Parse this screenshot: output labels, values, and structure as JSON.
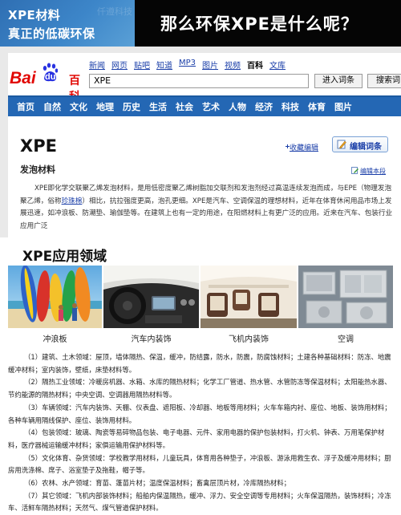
{
  "banner": {
    "line1": "XPE材料",
    "line2": "真正的低碳环保",
    "watermark": "仟遵科技",
    "question": "那么环保XPE是什么呢？"
  },
  "logo": {
    "bai": "Bai",
    "du": "du",
    "baike": "百科"
  },
  "top_nav": {
    "items": [
      "新闻",
      "网页",
      "贴吧",
      "知道",
      "MP3",
      "图片",
      "视频",
      "百科",
      "文库"
    ],
    "current": "百科"
  },
  "search": {
    "value": "XPE",
    "enter_label": "进入词条",
    "search_label": "搜索词"
  },
  "categories": [
    "首页",
    "自然",
    "文化",
    "地理",
    "历史",
    "生活",
    "社会",
    "艺术",
    "人物",
    "经济",
    "科技",
    "体育",
    "图片"
  ],
  "entry": {
    "title": "XPE",
    "favorite_label": "收藏编辑",
    "edit_label": "编辑词条",
    "subtitle": "发泡材料",
    "edit_section_label": "编辑本段",
    "paragraph_a": "XPE即化学交联聚乙烯发泡材料，是用低密度聚乙烯树脂加交联剂和发泡剂经过高温连续发泡而成，与EPE（物理发泡聚乙烯，俗称",
    "paragraph_link": "珍珠棉",
    "paragraph_b": "）相比，抗拉强度更高，泡孔更细。XPE是汽车、空调保温的理想材料，近年在体育休闲用品市场上发展迅速，如冲浪板、防潮垫、瑜伽垫等。在建筑上也有一定的用途，在阳燃材料上有更广泛的应用。近来在汽车、包装行业应用广泛"
  },
  "applications": {
    "title": "XPE应用领域",
    "photos": [
      {
        "caption": "冲浪板"
      },
      {
        "caption": "汽车内装饰"
      },
      {
        "caption": "飞机内装饰"
      },
      {
        "caption": "空调"
      }
    ],
    "items": [
      "（1）建筑、土木领域：屋顶，墙体隔热、保温，缓冲，防结露，防水，防震，防腐蚀材料；土建各种基础材料：防冻、地震缓冲材料；室内装饰，壁纸，床垫材料等。",
      "（2）隔热工业领域：冷暖房机器、水箱、水库的隔热材料；化学工厂管道、热水管、水管防冻等保温材料；太阳能热水器、节约能源的隔热材料；中央空调、空调器用隔热材料等。",
      "（3）车辆领域：汽车内装饰、天棚、仪表盘、遮阳板、冷却器、地板等用材料；火车车箱内衬、座位、地板、装饰用材料；各种车辆用隔线保护、座位、装饰用材料。",
      "（4）包装领域：玻璃、陶瓷等易碎物品包装、电子电器、元件、家用电器的保护包装材料，打火机、钟表、万用笔保护材料，医疗器械运输缓冲材料；家俱运输用保护材料等。",
      "（5）文化体育、杂货领域：学校教学用材料，儿童玩具，体育用各种垫子，冲浪板、游泳用救生衣、浮子及缓冲用材料；厨房用洗涤棉、席子、浴室垫子及拖鞋，帽子等。",
      "（6）农林、水产领域：育苗、蓬苗片材；温度保温材料；畜禽层顶片材，冷库隔热材料；",
      "（7）其它领域：飞机内部装饰材料；船舶内保温隔热，缓冲、浮力、安全空调等专用材料；火车保温隔热，装饰材料；冷冻车、活鲜车隔热材料；天然气、煤气管道保护材料。"
    ]
  },
  "colors": {
    "banner_blue": "#3d86c9",
    "nav_blue": "#2467b4",
    "link_blue": "#1a3ea8",
    "baidu_red": "#e10602"
  }
}
